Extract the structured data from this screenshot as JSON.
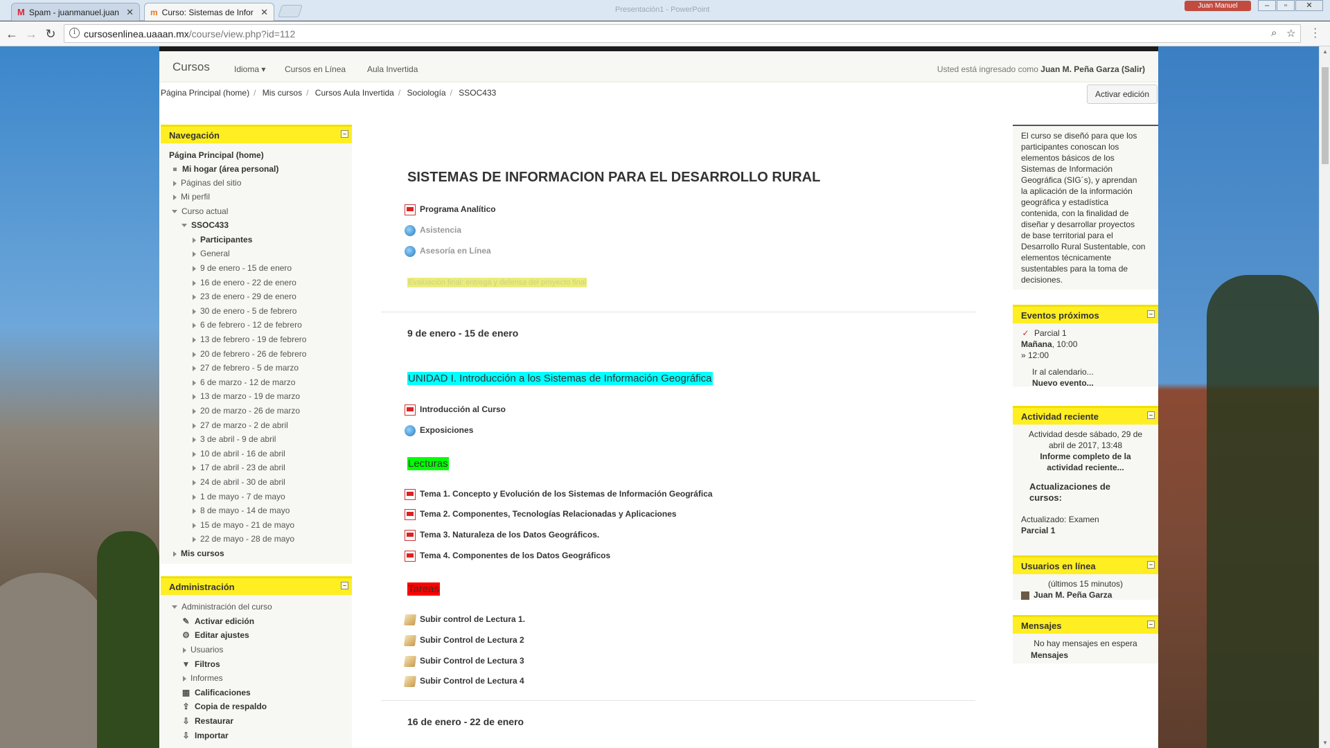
{
  "browser": {
    "tabs": [
      {
        "label": "Spam - juanmanuel.juan"
      },
      {
        "label": "Curso: Sistemas de Infor"
      }
    ],
    "window_title": "Presentación1 - PowerPoint",
    "user": "Juan Manuel",
    "url_host": "cursosenlinea.uaaan.mx",
    "url_path": "/course/view.php?id=112"
  },
  "navbar": {
    "brand": "Cursos",
    "links": [
      "Idioma",
      "Cursos en Línea",
      "Aula Invertida"
    ],
    "login_prefix": "Usted está ingresado como",
    "user_name": "Juan M. Peña Garza",
    "logout": "(Salir)"
  },
  "breadcrumb": [
    "Página Principal (home)",
    "Mis cursos",
    "Cursos Aula Invertida",
    "Sociología",
    "SSOC433"
  ],
  "edit_button": "Activar edición",
  "navigation": {
    "title": "Navegación",
    "home": "Página Principal (home)",
    "items": [
      "Mi hogar (área personal)",
      "Páginas del sitio",
      "Mi perfil",
      "Curso actual",
      "SSOC433",
      "Participantes",
      "General",
      "9 de enero - 15 de enero",
      "16 de enero - 22 de enero",
      "23 de enero - 29 de enero",
      "30 de enero - 5 de febrero",
      "6 de febrero - 12 de febrero",
      "13 de febrero - 19 de febrero",
      "20 de febrero - 26 de febrero",
      "27 de febrero - 5 de marzo",
      "6 de marzo - 12 de marzo",
      "13 de marzo - 19 de marzo",
      "20 de marzo - 26 de marzo",
      "27 de marzo - 2 de abril",
      "3 de abril - 9 de abril",
      "10 de abril - 16 de abril",
      "17 de abril - 23 de abril",
      "24 de abril - 30 de abril",
      "1 de mayo - 7 de mayo",
      "8 de mayo - 14 de mayo",
      "15 de mayo - 21 de mayo",
      "22 de mayo - 28 de mayo",
      "Mis cursos"
    ]
  },
  "administration": {
    "title": "Administración",
    "items": [
      "Administración del curso",
      "Activar edición",
      "Editar ajustes",
      "Usuarios",
      "Filtros",
      "Informes",
      "Calificaciones",
      "Copia de respaldo",
      "Restaurar",
      "Importar"
    ]
  },
  "course": {
    "title": "SISTEMAS DE INFORMACION PARA EL DESARROLLO RURAL",
    "top_resources": [
      "Programa Analítico",
      "Asistencia",
      "Asesoría en Línea"
    ],
    "hidden_note": "Evaluación final: entrega y defensa del proyecto final",
    "section1_title": "9 de enero - 15 de enero",
    "unit_title": "UNIDAD I. Introducción a los Sistemas de Información Geográfica",
    "unit_resources": [
      "Introducción al Curso",
      "Exposiciones"
    ],
    "readings_label": "Lecturas",
    "readings": [
      "Tema 1. Concepto y Evolución de los Sistemas de Información Geográfica",
      "Tema 2. Componentes, Tecnologías Relacionadas y Aplicaciones",
      "Tema 3. Naturaleza de los Datos Geográficos.",
      "Tema 4. Componentes de los Datos Geográficos"
    ],
    "tasks_label": "Tareas",
    "tasks": [
      "Subir control de Lectura 1.",
      "Subir Control de Lectura 2",
      "Subir Control de Lectura 3",
      "Subir Control de Lectura 4"
    ],
    "section2_title": "16 de enero - 22 de enero"
  },
  "summary": "El curso se diseñó para que los participantes conoscan los elementos básicos de los Sistemas de Información Geográfica (SIG´s), y aprendan la aplicación de la información geográfica y estadística contenida, con la finalidad de diseñar y desarrollar proyectos de base territorial para el Desarrollo Rural Sustentable, con elementos técnicamente sustentables para la toma de decisiones.",
  "events": {
    "title": "Eventos próximos",
    "event_name": "Parcial 1",
    "event_day": "Mañana",
    "event_time": ", 10:00",
    "event_end": "» 12:00",
    "calendar": "Ir al calendario...",
    "new_event": "Nuevo evento..."
  },
  "recent": {
    "title": "Actividad reciente",
    "since": "Actividad desde sábado, 29 de abril de 2017, 13:48",
    "report": "Informe completo de la actividad reciente...",
    "updates_title": "Actualizaciones de cursos:",
    "updated_label": "Actualizado: Examen",
    "updated_item": "Parcial 1"
  },
  "online": {
    "title": "Usuarios en línea",
    "subtitle": "(últimos 15 minutos)",
    "user": "Juan M. Peña Garza"
  },
  "messages": {
    "title": "Mensajes",
    "empty": "No hay mensajes en espera",
    "link": "Mensajes"
  },
  "colors": {
    "block_header": "#ffee22",
    "highlight_cyan": "#00ffff",
    "highlight_green": "#00ff00",
    "highlight_red": "#ff0000"
  }
}
